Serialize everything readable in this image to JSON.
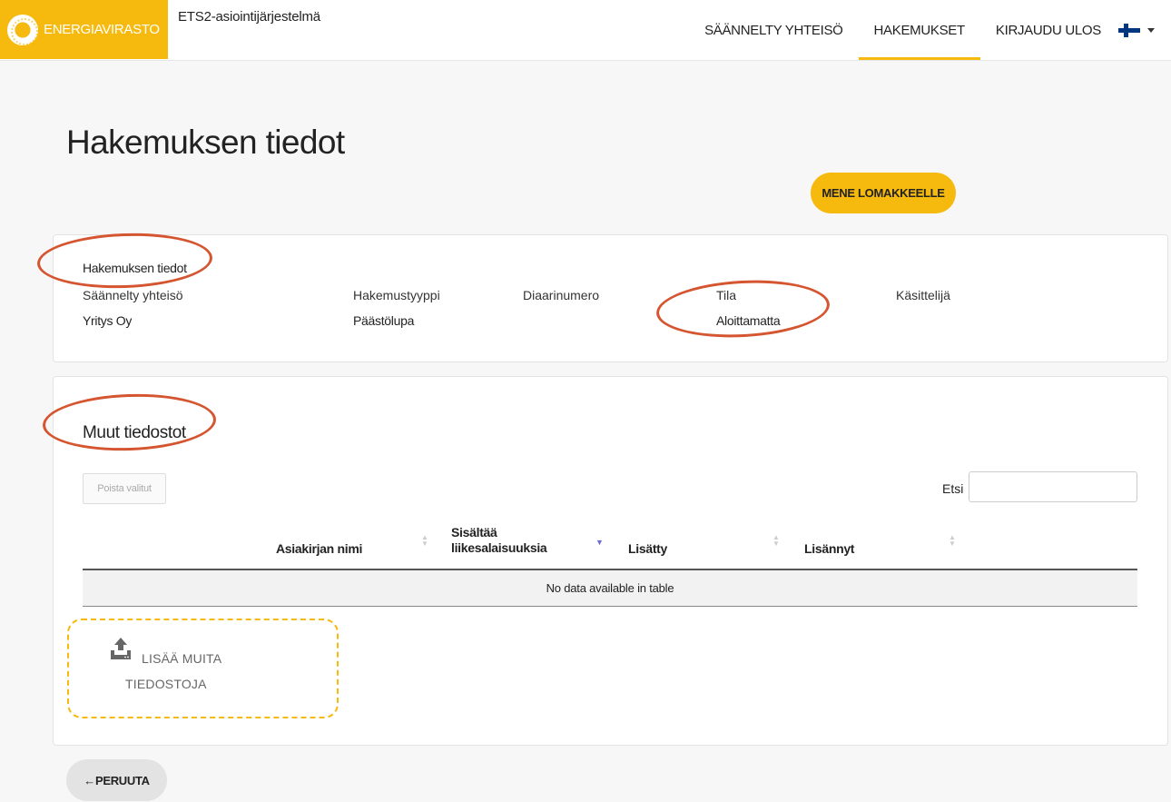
{
  "header": {
    "logo_text": "ENERGIAVIRASTO",
    "app_name": "ETS2-asiointijärjestelmä",
    "nav": [
      {
        "label": "SÄÄNNELTY YHTEISÖ"
      },
      {
        "label": "HAKEMUKSET"
      },
      {
        "label": "KIRJAUDU ULOS"
      }
    ]
  },
  "page_title": "Hakemuksen tiedot",
  "go_to_form_label": "MENE LOMAKKEELLE",
  "details": {
    "section_title": "Hakemuksen tiedot",
    "fields": [
      {
        "label": "Säännelty yhteisö",
        "value": "Yritys Oy"
      },
      {
        "label": "Hakemustyyppi",
        "value": "Päästölupa"
      },
      {
        "label": "Diaarinumero",
        "value": ""
      },
      {
        "label": "Tila",
        "value": "Aloittamatta"
      },
      {
        "label": "Käsittelijä",
        "value": ""
      }
    ]
  },
  "files": {
    "section_title": "Muut tiedostot",
    "delete_label": "Poista valitut",
    "search_label": "Etsi",
    "columns": [
      {
        "line1": "Asiakirjan nimi",
        "line2": ""
      },
      {
        "line1": "Sisältää",
        "line2": "liikesalaisuuksia"
      },
      {
        "line1": "Lisätty",
        "line2": ""
      },
      {
        "line1": "Lisännyt",
        "line2": ""
      }
    ],
    "empty_text": "No data available in table",
    "upload_line1": "LISÄÄ MUITA",
    "upload_line2": "TIEDOSTOJA"
  },
  "cancel_label": "←PERUUTA",
  "colors": {
    "accent": "#f6b90d",
    "annotation": "#d4552f"
  }
}
